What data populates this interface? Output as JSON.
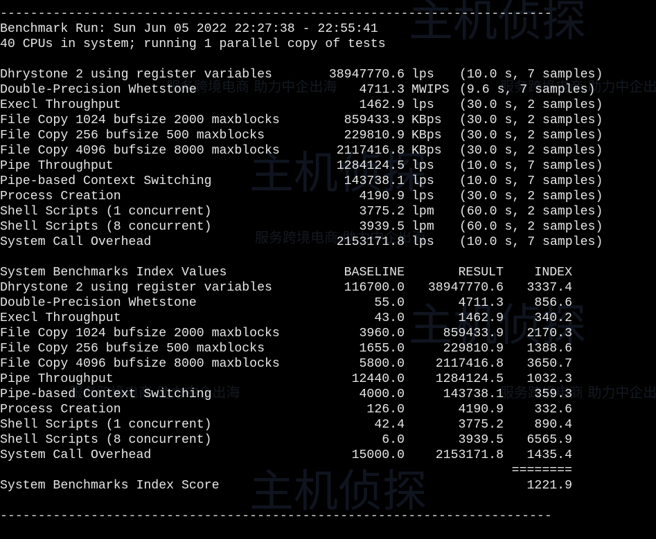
{
  "terminal": {
    "separator_top": "-------------------------------------------------------------------------",
    "run_line": "Benchmark Run: Sun Jun 05 2022 22:27:38 - 22:55:41",
    "cpu_line": "40 CPUs in system; running 1 parallel copy of tests",
    "raw_results": [
      {
        "name": "Dhrystone 2 using register variables",
        "value": "38947770.6",
        "unit": "lps",
        "detail": "(10.0 s, 7 samples)"
      },
      {
        "name": "Double-Precision Whetstone",
        "value": "4711.3",
        "unit": "MWIPS",
        "detail": "(9.6 s, 7 samples)"
      },
      {
        "name": "Execl Throughput",
        "value": "1462.9",
        "unit": "lps",
        "detail": "(30.0 s, 2 samples)"
      },
      {
        "name": "File Copy 1024 bufsize 2000 maxblocks",
        "value": "859433.9",
        "unit": "KBps",
        "detail": "(30.0 s, 2 samples)"
      },
      {
        "name": "File Copy 256 bufsize 500 maxblocks",
        "value": "229810.9",
        "unit": "KBps",
        "detail": "(30.0 s, 2 samples)"
      },
      {
        "name": "File Copy 4096 bufsize 8000 maxblocks",
        "value": "2117416.8",
        "unit": "KBps",
        "detail": "(30.0 s, 2 samples)"
      },
      {
        "name": "Pipe Throughput",
        "value": "1284124.5",
        "unit": "lps",
        "detail": "(10.0 s, 7 samples)"
      },
      {
        "name": "Pipe-based Context Switching",
        "value": "143738.1",
        "unit": "lps",
        "detail": "(10.0 s, 7 samples)"
      },
      {
        "name": "Process Creation",
        "value": "4190.9",
        "unit": "lps",
        "detail": "(30.0 s, 2 samples)"
      },
      {
        "name": "Shell Scripts (1 concurrent)",
        "value": "3775.2",
        "unit": "lpm",
        "detail": "(60.0 s, 2 samples)"
      },
      {
        "name": "Shell Scripts (8 concurrent)",
        "value": "3939.5",
        "unit": "lpm",
        "detail": "(60.0 s, 2 samples)"
      },
      {
        "name": "System Call Overhead",
        "value": "2153171.8",
        "unit": "lps",
        "detail": "(10.0 s, 7 samples)"
      }
    ],
    "index_header": {
      "title": "System Benchmarks Index Values",
      "baseline": "BASELINE",
      "result": "RESULT",
      "index": "INDEX"
    },
    "index_rows": [
      {
        "name": "Dhrystone 2 using register variables",
        "baseline": "116700.0",
        "result": "38947770.6",
        "index": "3337.4"
      },
      {
        "name": "Double-Precision Whetstone",
        "baseline": "55.0",
        "result": "4711.3",
        "index": "856.6"
      },
      {
        "name": "Execl Throughput",
        "baseline": "43.0",
        "result": "1462.9",
        "index": "340.2"
      },
      {
        "name": "File Copy 1024 bufsize 2000 maxblocks",
        "baseline": "3960.0",
        "result": "859433.9",
        "index": "2170.3"
      },
      {
        "name": "File Copy 256 bufsize 500 maxblocks",
        "baseline": "1655.0",
        "result": "229810.9",
        "index": "1388.6"
      },
      {
        "name": "File Copy 4096 bufsize 8000 maxblocks",
        "baseline": "5800.0",
        "result": "2117416.8",
        "index": "3650.7"
      },
      {
        "name": "Pipe Throughput",
        "baseline": "12440.0",
        "result": "1284124.5",
        "index": "1032.3"
      },
      {
        "name": "Pipe-based Context Switching",
        "baseline": "4000.0",
        "result": "143738.1",
        "index": "359.3"
      },
      {
        "name": "Process Creation",
        "baseline": "126.0",
        "result": "4190.9",
        "index": "332.6"
      },
      {
        "name": "Shell Scripts (1 concurrent)",
        "baseline": "42.4",
        "result": "3775.2",
        "index": "890.4"
      },
      {
        "name": "Shell Scripts (8 concurrent)",
        "baseline": "6.0",
        "result": "3939.5",
        "index": "6565.9"
      },
      {
        "name": "System Call Overhead",
        "baseline": "15000.0",
        "result": "2153171.8",
        "index": "1435.4"
      }
    ],
    "index_rule": "========",
    "score_label": "System Benchmarks Index Score",
    "score_value": "1221.9",
    "separator_bottom": "-------------------------------------------------------------------------"
  },
  "watermark": {
    "brand": "主机侦探",
    "slogan": "服务跨境电商 助力中企出海"
  },
  "colors": {
    "background": "#000000",
    "text": "#e6e6e6",
    "watermark": "#6a8fd0"
  }
}
